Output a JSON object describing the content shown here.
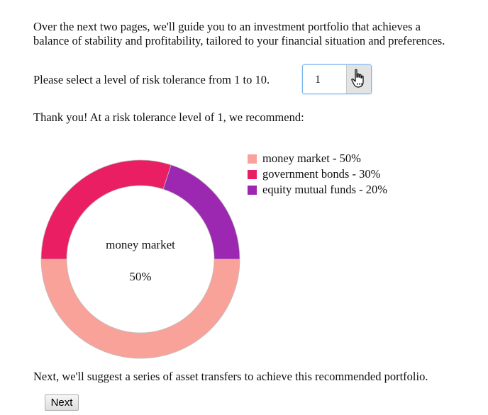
{
  "intro": {
    "line1": "Over the next two pages, we'll guide you to an investment portfolio that achieves a",
    "line2": "balance of stability and profitability, tailored to your financial situation and preferences."
  },
  "risk": {
    "prompt": "Please select a level of risk tolerance from 1 to 10.",
    "value": "1",
    "cursor_icon": "hand-pointer-icon"
  },
  "recommendation": {
    "text": "Thank you! At a risk tolerance level of 1, we recommend:"
  },
  "chart_data": {
    "type": "pie",
    "title": "",
    "center_label": "money market",
    "center_value": "50%",
    "slices": [
      {
        "name": "money market",
        "value": 50,
        "color": "#f8a29a",
        "legend": "money market - 50%"
      },
      {
        "name": "government bonds",
        "value": 30,
        "color": "#e91e63",
        "legend": "government bonds - 30%"
      },
      {
        "name": "equity mutual funds",
        "value": 20,
        "color": "#9c27b0",
        "legend": "equity mutual funds - 20%"
      }
    ],
    "legend_position": "right"
  },
  "footer": {
    "text": "Next, we'll suggest a series of asset transfers to achieve this recommended portfolio.",
    "next_label": "Next"
  }
}
